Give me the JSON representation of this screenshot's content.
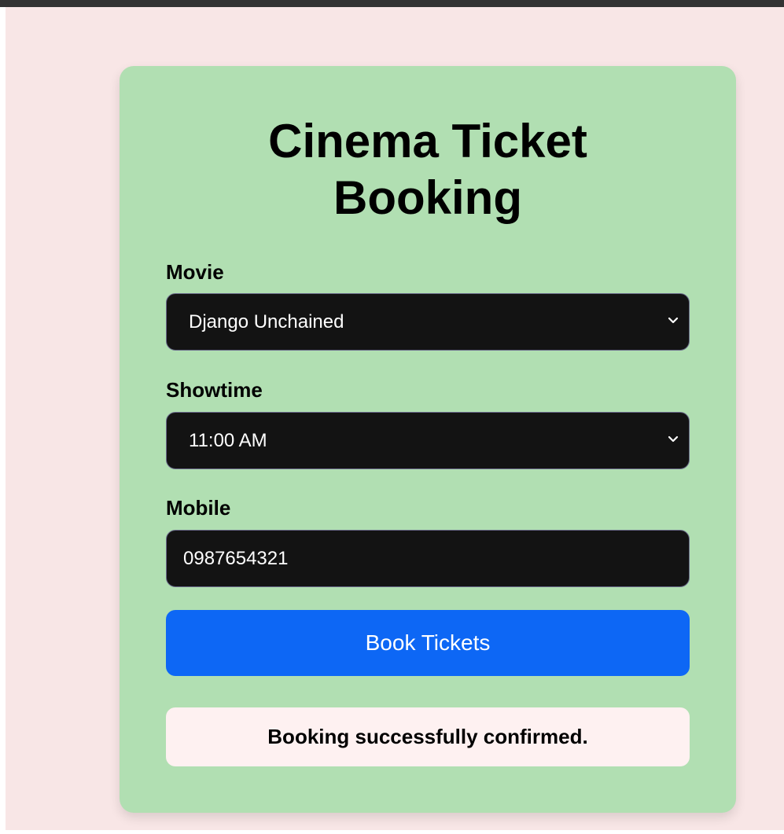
{
  "page": {
    "title_line1": "Cinema Ticket",
    "title_line2": "Booking"
  },
  "form": {
    "movie_label": "Movie",
    "movie_value": "Django Unchained",
    "showtime_label": "Showtime",
    "showtime_value": "11:00 AM",
    "mobile_label": "Mobile",
    "mobile_value": "0987654321",
    "submit_label": "Book Tickets"
  },
  "status": {
    "message": "Booking successfully confirmed."
  },
  "icons": {
    "select_indicator": "chevron-down-icon"
  },
  "colors": {
    "page_background": "#f8e6e6",
    "card_background": "#b1dfb2",
    "control_background": "#131313",
    "button_background": "#0d67f5",
    "message_background": "#fef1f1"
  }
}
